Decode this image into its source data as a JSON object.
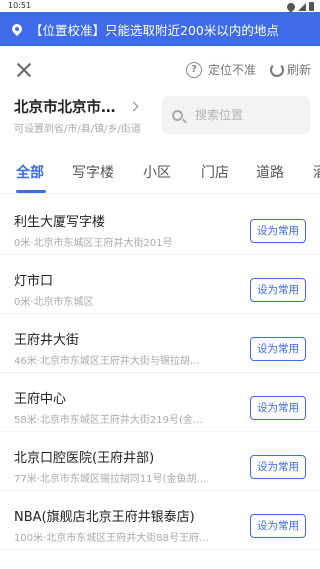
{
  "status_bar": {
    "time": "10:51",
    "icons": [
      "wifi-icon",
      "signal-icon",
      "battery-icon"
    ]
  },
  "banner": {
    "icon": "location-pin-icon",
    "text": "【位置校准】只能选取附近200米以内的地点",
    "color": "#3d6bea"
  },
  "top_bar": {
    "close_icon": "close-icon",
    "inaccurate_icon": "question-circle-icon",
    "inaccurate_label": "定位不准",
    "refresh_icon": "refresh-icon",
    "refresh_label": "刷新"
  },
  "location": {
    "city": "北京市北京市…",
    "hint": "可设置到省/市/县/镇/乡/街道"
  },
  "search": {
    "placeholder": "搜索位置"
  },
  "tabs": [
    {
      "label": "全部",
      "active": true
    },
    {
      "label": "写字楼",
      "active": false
    },
    {
      "label": "小区",
      "active": false
    },
    {
      "label": "门店",
      "active": false
    },
    {
      "label": "道路",
      "active": false
    },
    {
      "label": "酒",
      "active": false
    }
  ],
  "accent_color": "#3d6bea",
  "places": [
    {
      "name": "利生大厦写字楼",
      "address": "0米·北京市东城区王府井大街201号",
      "button": "设为常用"
    },
    {
      "name": "灯市口",
      "address": "0米·北京市东城区",
      "button": "设为常用"
    },
    {
      "name": "王府井大街",
      "address": "46米·北京市东城区王府井大街与锡拉胡…",
      "button": "设为常用"
    },
    {
      "name": "王府中心",
      "address": "58米·北京市东城区王府井大街219号(金…",
      "button": "设为常用"
    },
    {
      "name": "北京口腔医院(王府井部)",
      "address": "77米·北京市东城区锡拉胡同11号(金鱼胡…",
      "button": "设为常用"
    },
    {
      "name": "NBA(旗舰店北京王府井银泰店)",
      "address": "100米·北京市东城区王府井大街88号王府…",
      "button": "设为常用"
    }
  ]
}
